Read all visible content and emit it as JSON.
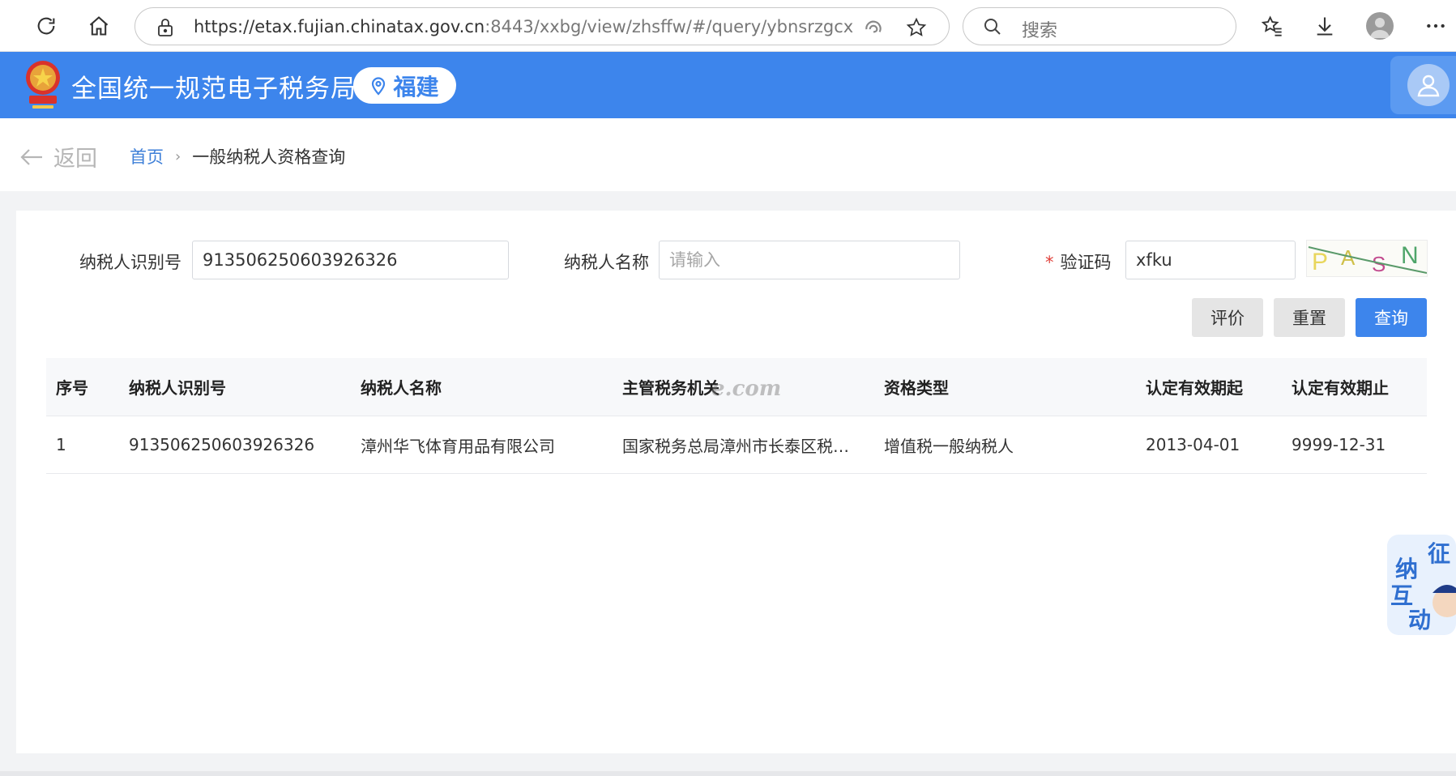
{
  "browser": {
    "url_main": "https://etax.fujian.chinatax.gov.cn",
    "url_rest": ":8443/xxbg/view/zhsffw/#/query/ybnsrzgcx",
    "search_placeholder": "搜索",
    "icons": [
      "refresh-icon",
      "home-icon",
      "lock-icon",
      "edge-icon",
      "star-icon",
      "search-icon",
      "favorites-icon",
      "download-icon",
      "profile-icon",
      "more-icon"
    ]
  },
  "header": {
    "title": "全国统一规范电子税务局",
    "region": "福建",
    "brand_color": "#3d85ec"
  },
  "breadcrumb": {
    "back_label": "返回",
    "home": "首页",
    "separator": "›",
    "current": "一般纳税人资格查询"
  },
  "form": {
    "tax_id_label": "纳税人识别号",
    "tax_id_value": "913506250603926326",
    "name_label": "纳税人名称",
    "name_placeholder": "请输入",
    "captcha_required": "*",
    "captcha_label": "验证码",
    "captcha_value": "xfku",
    "captcha_chars": [
      "P",
      "A",
      "S",
      "N"
    ]
  },
  "buttons": {
    "rate": "评价",
    "reset": "重置",
    "query": "查询"
  },
  "table": {
    "columns": [
      "序号",
      "纳税人识别号",
      "纳税人名称",
      "主管税务机关",
      "资格类型",
      "认定有效期起",
      "认定有效期止"
    ],
    "rows": [
      {
        "index": "1",
        "tax_id": "913506250603926326",
        "name": "漳州华飞体育用品有限公司",
        "authority": "国家税务总局漳州市长泰区税…",
        "type": "增值税一般纳税人",
        "start": "2013-04-01",
        "end": "9999-12-31"
      }
    ]
  },
  "watermark": "e.com",
  "widget": {
    "chars": [
      "征",
      "纳",
      "互",
      "动"
    ]
  }
}
